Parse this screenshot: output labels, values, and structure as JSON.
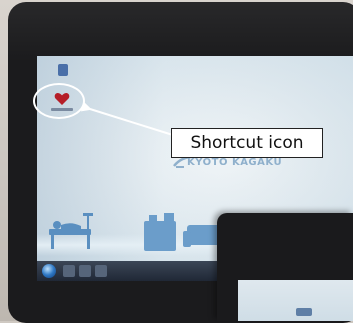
{
  "annotation": {
    "callout_text": "Shortcut icon",
    "color": "#ffffff"
  },
  "wallpaper": {
    "logo_text": "KYOTO KAGAKU"
  },
  "colors": {
    "bezel": "#1b1b1d",
    "taskbar": "#202836",
    "screen": "#dfe9ef",
    "logo": "#8fb0cc"
  },
  "icons": {
    "desktop_top": "app-icon",
    "desktop_shortcut": "heart-icon",
    "start": "start-orb-icon"
  }
}
